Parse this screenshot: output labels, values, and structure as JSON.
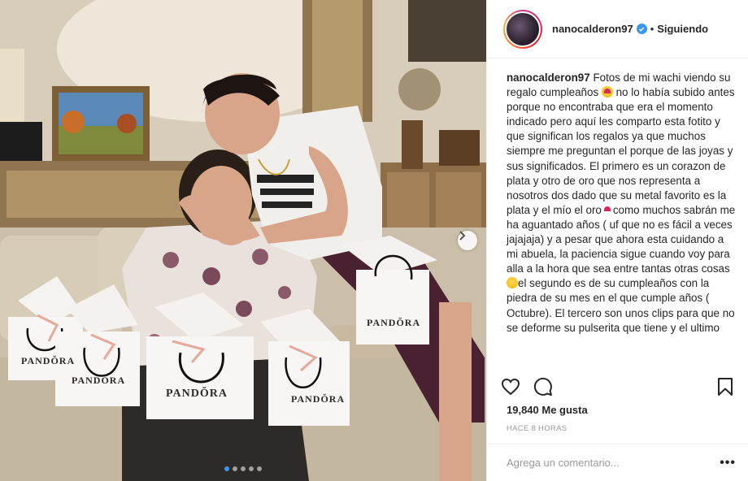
{
  "post": {
    "photo_alt": "",
    "package_label": "PANDŎRA",
    "carousel": {
      "count": 5,
      "active": 0
    }
  },
  "header": {
    "username": "nanocalderon97",
    "separator": "•",
    "follow_label": "Siguiendo"
  },
  "caption": {
    "username": "nanocalderon97",
    "part1": "Fotos de mi wachi viendo su regalo cumpleaños ",
    "part2": "no lo había subido antes porque no encontraba que era el momento indicado pero aquí les comparto esta fotito y que significan los regalos ya que muchos siempre me preguntan el porque de las joyas y sus significados. El primero es un corazon de plata y otro de oro que nos representa a nosotros dos dado que su metal favorito es la plata y el mío el oro",
    "part3": "como muchos sabrán me ha aguantado años ( uf que no es fácil a veces jajajaja) y a pesar que ahora esta cuidando a mi abuela, la paciencia sigue cuando voy para alla a la hora que sea entre tantas otras cosas ",
    "part4": "el segundo es de su cumpleaños con la piedra de su mes en el que cumple años ( Octubre). El tercero son unos clips para que no se deforme su pulserita que tiene y el ultimo"
  },
  "stats": {
    "likes": "19,840 Me gusta",
    "timestamp": "HACE 8 HORAS"
  },
  "comment": {
    "placeholder": "Agrega un comentario...",
    "more_label": "•••"
  }
}
